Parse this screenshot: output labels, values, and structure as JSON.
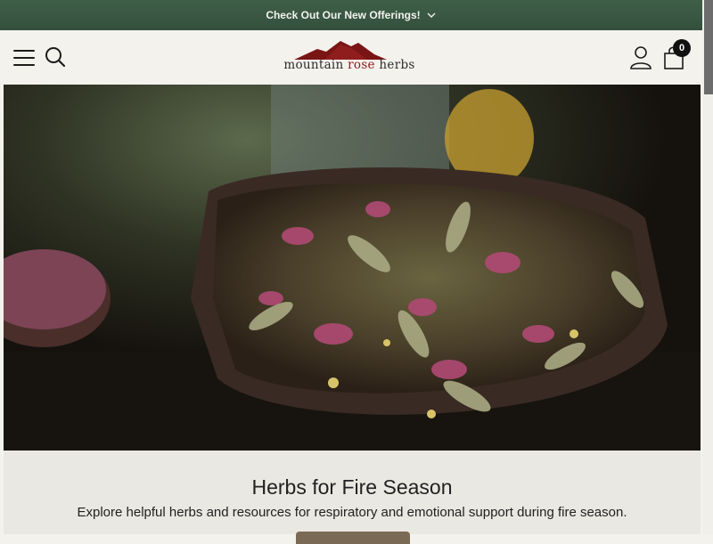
{
  "announcement": {
    "text": "Check Out Our New Offerings!",
    "icon": "chevron-down-icon"
  },
  "header": {
    "menu_icon": "hamburger-menu-icon",
    "search_icon": "search-icon",
    "logo": {
      "part1": "mountain ",
      "part2": "rose",
      "part3": " herbs"
    },
    "account_icon": "user-icon",
    "cart_icon": "shopping-bag-icon",
    "cart_count": "0"
  },
  "hero": {
    "image": "bowl of dried herbs with rose petals and oat tops"
  },
  "promo": {
    "title": "Herbs for Fire Season",
    "subtitle": "Explore helpful herbs and resources for respiratory and emotional support during fire season."
  },
  "colors": {
    "announce_bg": "#3f5f48",
    "header_bg": "#f4f2ed",
    "logo_accent": "#8a1c1c",
    "content_bg": "#eae8e2",
    "cta": "#7a6a55"
  }
}
